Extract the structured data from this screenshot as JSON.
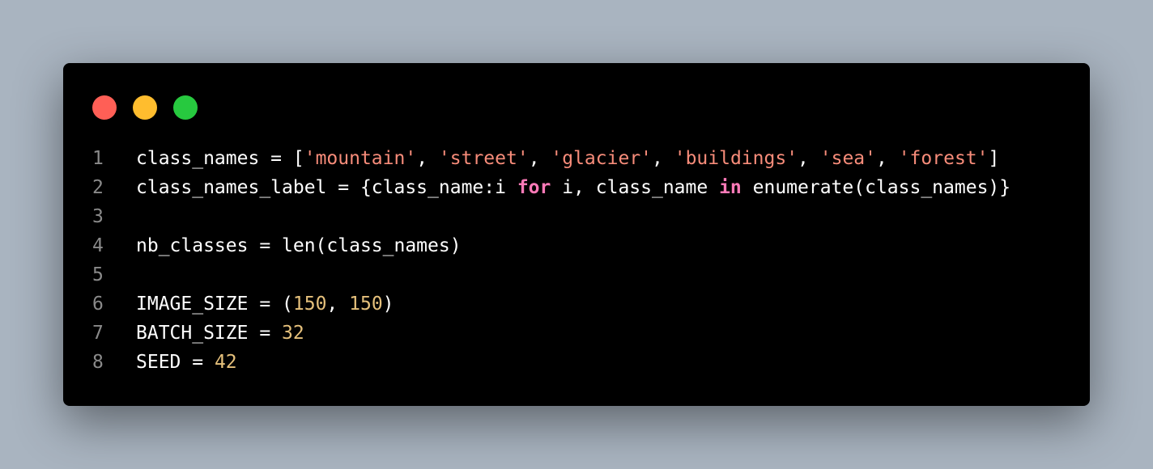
{
  "window": {
    "traffic_lights": [
      {
        "name": "close",
        "color": "#ff5f56"
      },
      {
        "name": "minimize",
        "color": "#ffbd2e"
      },
      {
        "name": "zoom",
        "color": "#27c93f"
      }
    ]
  },
  "colors": {
    "string": "#f78c7a",
    "keyword": "#ff7ab8",
    "number": "#e5c07b",
    "plain": "#ffffff",
    "line_number": "#8a8a8a"
  },
  "code": {
    "lines": [
      {
        "number": "1",
        "tokens": [
          {
            "t": "plain",
            "v": "class_names = ["
          },
          {
            "t": "str",
            "v": "'mountain'"
          },
          {
            "t": "plain",
            "v": ", "
          },
          {
            "t": "str",
            "v": "'street'"
          },
          {
            "t": "plain",
            "v": ", "
          },
          {
            "t": "str",
            "v": "'glacier'"
          },
          {
            "t": "plain",
            "v": ", "
          },
          {
            "t": "str",
            "v": "'buildings'"
          },
          {
            "t": "plain",
            "v": ", "
          },
          {
            "t": "str",
            "v": "'sea'"
          },
          {
            "t": "plain",
            "v": ", "
          },
          {
            "t": "str",
            "v": "'forest'"
          },
          {
            "t": "plain",
            "v": "]"
          }
        ]
      },
      {
        "number": "2",
        "tokens": [
          {
            "t": "plain",
            "v": "class_names_label = {class_name:i "
          },
          {
            "t": "kw",
            "v": "for"
          },
          {
            "t": "plain",
            "v": " i, class_name "
          },
          {
            "t": "kw",
            "v": "in"
          },
          {
            "t": "plain",
            "v": " enumerate(class_names)}"
          }
        ]
      },
      {
        "number": "3",
        "tokens": []
      },
      {
        "number": "4",
        "tokens": [
          {
            "t": "plain",
            "v": "nb_classes = len(class_names)"
          }
        ]
      },
      {
        "number": "5",
        "tokens": []
      },
      {
        "number": "6",
        "tokens": [
          {
            "t": "plain",
            "v": "IMAGE_SIZE = ("
          },
          {
            "t": "num",
            "v": "150"
          },
          {
            "t": "plain",
            "v": ", "
          },
          {
            "t": "num",
            "v": "150"
          },
          {
            "t": "plain",
            "v": ")"
          }
        ]
      },
      {
        "number": "7",
        "tokens": [
          {
            "t": "plain",
            "v": "BATCH_SIZE = "
          },
          {
            "t": "num",
            "v": "32"
          }
        ]
      },
      {
        "number": "8",
        "tokens": [
          {
            "t": "plain",
            "v": "SEED = "
          },
          {
            "t": "num",
            "v": "42"
          }
        ]
      }
    ]
  }
}
